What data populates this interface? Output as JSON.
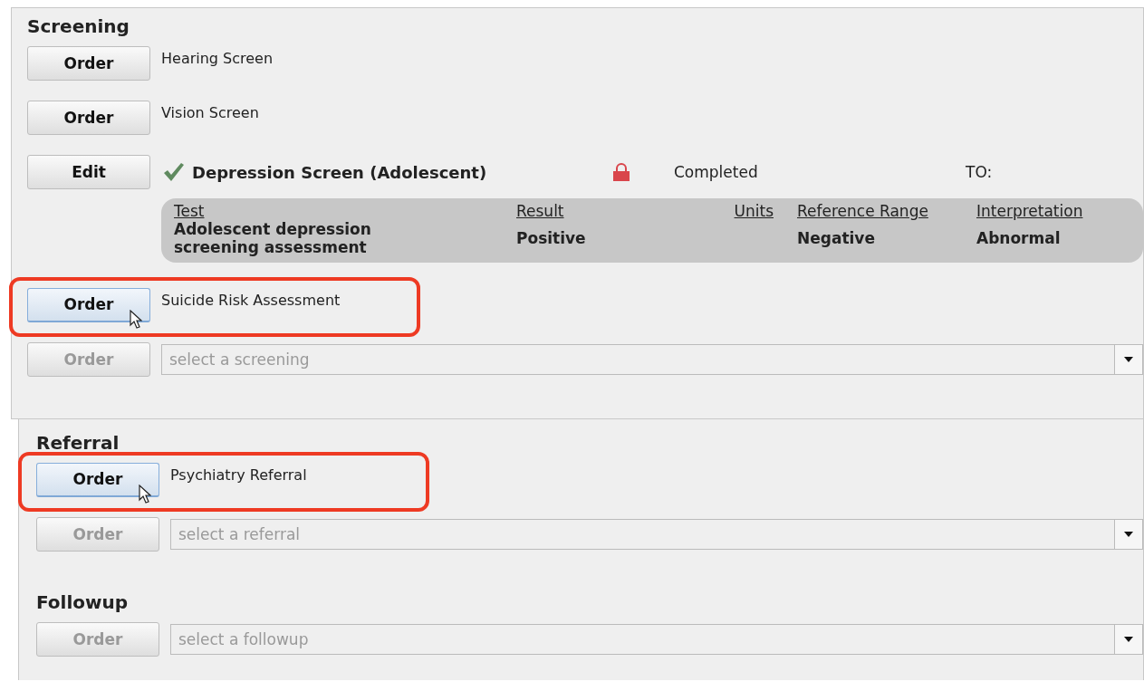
{
  "sections": [
    {
      "title": "Screening",
      "items": [
        {
          "kind": "orderable",
          "button": "Order",
          "label": "Hearing Screen",
          "highlighted": false
        },
        {
          "kind": "orderable",
          "button": "Order",
          "label": "Vision Screen",
          "highlighted": false
        },
        {
          "kind": "completed",
          "button": "Edit",
          "label": "Depression Screen (Adolescent)",
          "locked": true,
          "status": "Completed",
          "to_label": "TO:",
          "results": {
            "columns": [
              "Test",
              "Result",
              "Units",
              "Reference Range",
              "Interpretation"
            ],
            "rows": [
              [
                "Adolescent depression screening assessment",
                "Positive",
                "",
                "Negative",
                "Abnormal"
              ]
            ]
          }
        },
        {
          "kind": "orderable",
          "button": "Order",
          "label": "Suicide Risk Assessment",
          "highlighted": true
        }
      ],
      "picker": {
        "button": "Order",
        "disabled": true,
        "placeholder": "select a screening"
      }
    },
    {
      "title": "Referral",
      "items": [
        {
          "kind": "orderable",
          "button": "Order",
          "label": "Psychiatry Referral",
          "highlighted": true
        }
      ],
      "picker": {
        "button": "Order",
        "disabled": true,
        "placeholder": "select a referral"
      }
    },
    {
      "title": "Followup",
      "picker": {
        "button": "Order",
        "disabled": true,
        "placeholder": "select a followup"
      }
    }
  ]
}
